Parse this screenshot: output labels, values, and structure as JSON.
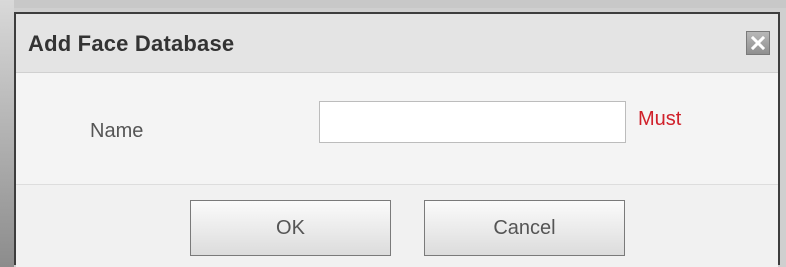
{
  "dialog": {
    "title": "Add Face Database",
    "close_icon": "close-icon"
  },
  "form": {
    "name_label": "Name",
    "name_value": "",
    "name_placeholder": "",
    "required_text": "Must"
  },
  "buttons": {
    "ok_label": "OK",
    "cancel_label": "Cancel"
  },
  "colors": {
    "required": "#d0202a",
    "dialog_border": "#3d3d3d",
    "header_background": "#e4e4e4"
  }
}
